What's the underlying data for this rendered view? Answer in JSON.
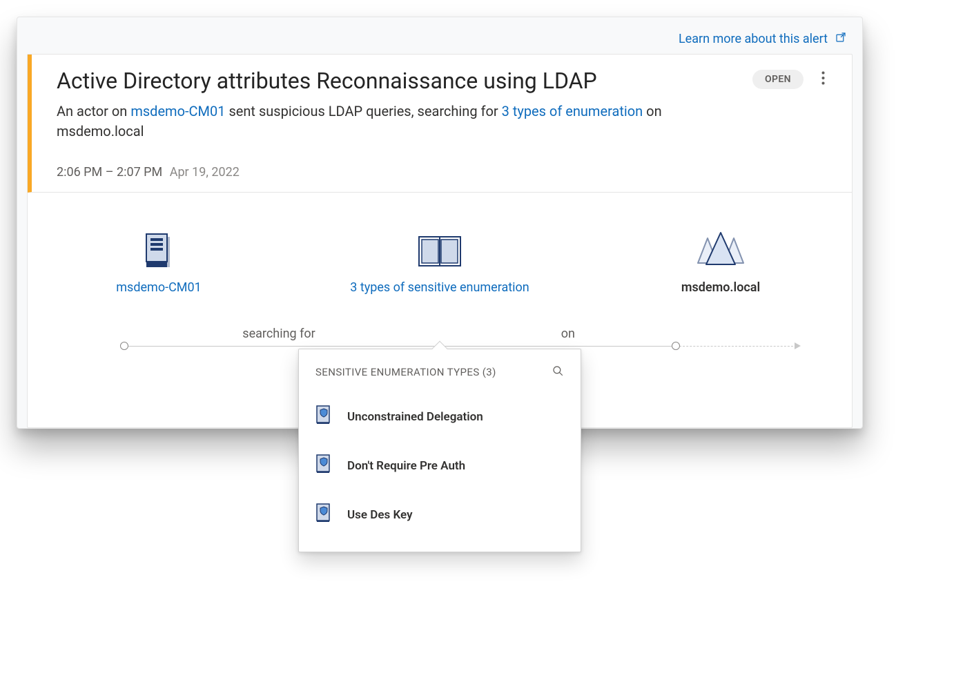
{
  "learn_more_label": "Learn more about this alert",
  "alert": {
    "title": "Active Directory attributes Reconnaissance using LDAP",
    "status_badge": "OPEN",
    "description_prefix": "An actor on ",
    "description_host": "msdemo-CM01",
    "description_mid": " sent suspicious LDAP queries, searching for ",
    "description_link": "3 types of enumeration",
    "description_suffix_on": " on ",
    "description_domain": "msdemo.local",
    "time_range": "2:06 PM – 2:07 PM",
    "date": "Apr 19, 2022"
  },
  "diagram": {
    "source_label": "msdemo-CM01",
    "center_label": "3 types of sensitive enumeration",
    "target_label": "msdemo.local",
    "segment1_label": "searching for",
    "segment2_label": "on"
  },
  "popover": {
    "title": "SENSITIVE ENUMERATION TYPES (3)",
    "items": [
      {
        "label": "Unconstrained Delegation"
      },
      {
        "label": "Don't Require Pre Auth"
      },
      {
        "label": "Use Des Key"
      }
    ]
  }
}
